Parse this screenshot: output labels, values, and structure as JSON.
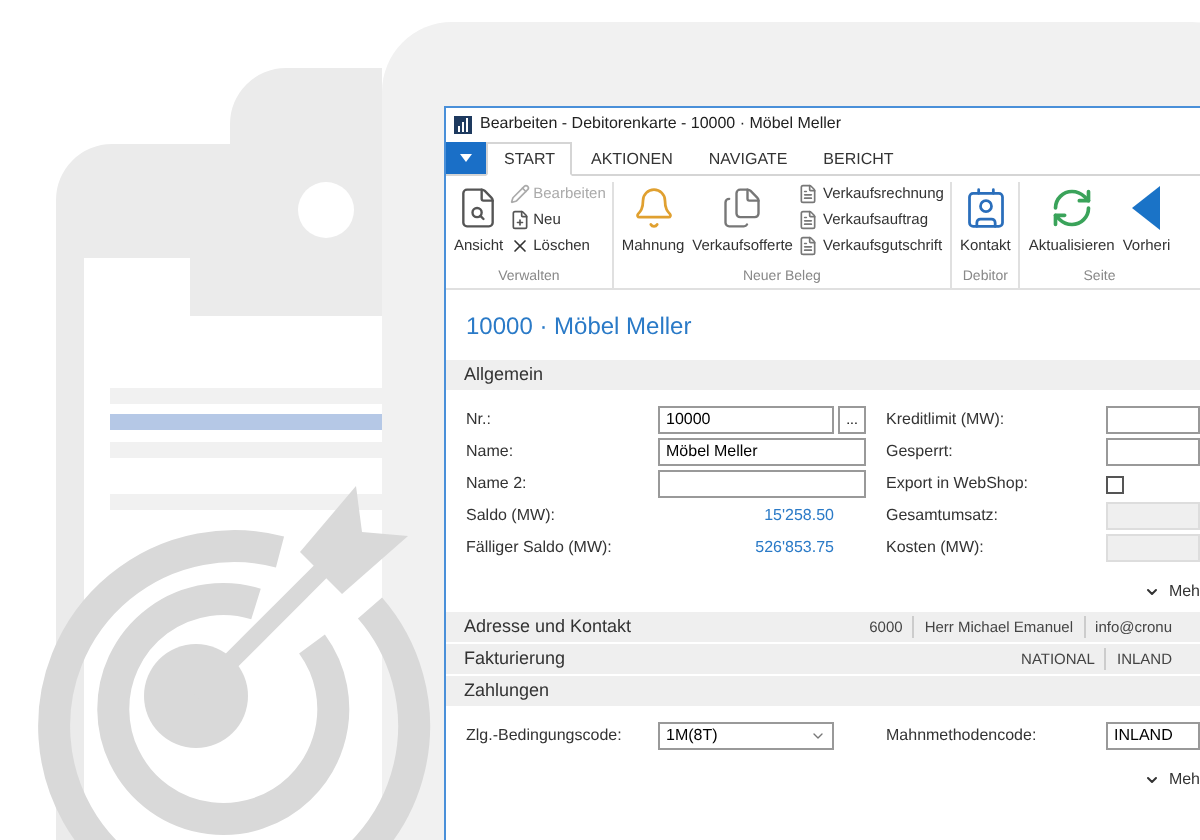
{
  "window": {
    "title": "Bearbeiten - Debitorenkarte - 10000 · Möbel Meller"
  },
  "tabs": [
    {
      "label": "START",
      "selected": true
    },
    {
      "label": "AKTIONEN",
      "selected": false
    },
    {
      "label": "NAVIGATE",
      "selected": false
    },
    {
      "label": "BERICHT",
      "selected": false
    }
  ],
  "ribbon_groups": [
    {
      "label": "Verwalten",
      "large": [
        {
          "label": "Ansicht"
        }
      ],
      "small": [
        {
          "label": "Bearbeiten",
          "disabled": true
        },
        {
          "label": "Neu",
          "disabled": false
        },
        {
          "label": "Löschen",
          "disabled": false
        }
      ]
    },
    {
      "label": "Neuer Beleg",
      "large": [
        {
          "label": "Mahnung"
        },
        {
          "label": "Verkaufsofferte"
        }
      ],
      "small": [
        {
          "label": "Verkaufsrechnung",
          "disabled": false
        },
        {
          "label": "Verkaufsauftrag",
          "disabled": false
        },
        {
          "label": "Verkaufsgutschrift",
          "disabled": false
        }
      ]
    },
    {
      "label": "Debitor",
      "large": [
        {
          "label": "Kontakt"
        }
      ]
    },
    {
      "label": "Seite",
      "large": [
        {
          "label": "Aktualisieren"
        },
        {
          "label": "Vorheri"
        }
      ]
    }
  ],
  "page_title": "10000 · Möbel Meller",
  "sections": [
    {
      "title": "Allgemein",
      "left_fields": [
        {
          "label": "Nr.:",
          "kind": "input",
          "value": "10000",
          "lookup": "..."
        },
        {
          "label": "Name:",
          "kind": "input",
          "value": "Möbel Meller"
        },
        {
          "label": "Name 2:",
          "kind": "input"
        },
        {
          "label": "Saldo (MW):",
          "kind": "amount",
          "value": "15'258.50"
        },
        {
          "label": "Fälliger Saldo (MW):",
          "kind": "amount",
          "value": "526'853.75"
        }
      ],
      "right_fields": [
        {
          "label": "Kreditlimit (MW):",
          "kind": "input",
          "disabled": false
        },
        {
          "label": "Gesperrt:",
          "kind": "input",
          "disabled": false
        },
        {
          "label": "Export in WebShop:",
          "kind": "checkbox",
          "checked": false
        },
        {
          "label": "Gesamtumsatz:",
          "kind": "input",
          "disabled": true
        },
        {
          "label": "Kosten (MW):",
          "kind": "input",
          "disabled": true
        }
      ],
      "more": "Meh"
    },
    {
      "title": "Adresse und Kontakt",
      "summary": [
        "6000",
        "Herr Michael Emanuel",
        "info@cronu"
      ]
    },
    {
      "title": "Fakturierung",
      "summary": [
        "NATIONAL",
        "INLAND"
      ]
    },
    {
      "title": "Zahlungen",
      "left_fields": [
        {
          "label": "Zlg.-Bedingungscode:",
          "kind": "dropdown",
          "value": "1M(8T)"
        }
      ],
      "right_fields": [
        {
          "label": "Mahnmethodencode:",
          "kind": "input",
          "value": "INLAND",
          "disabled": false
        }
      ],
      "more": "Meh"
    }
  ]
}
